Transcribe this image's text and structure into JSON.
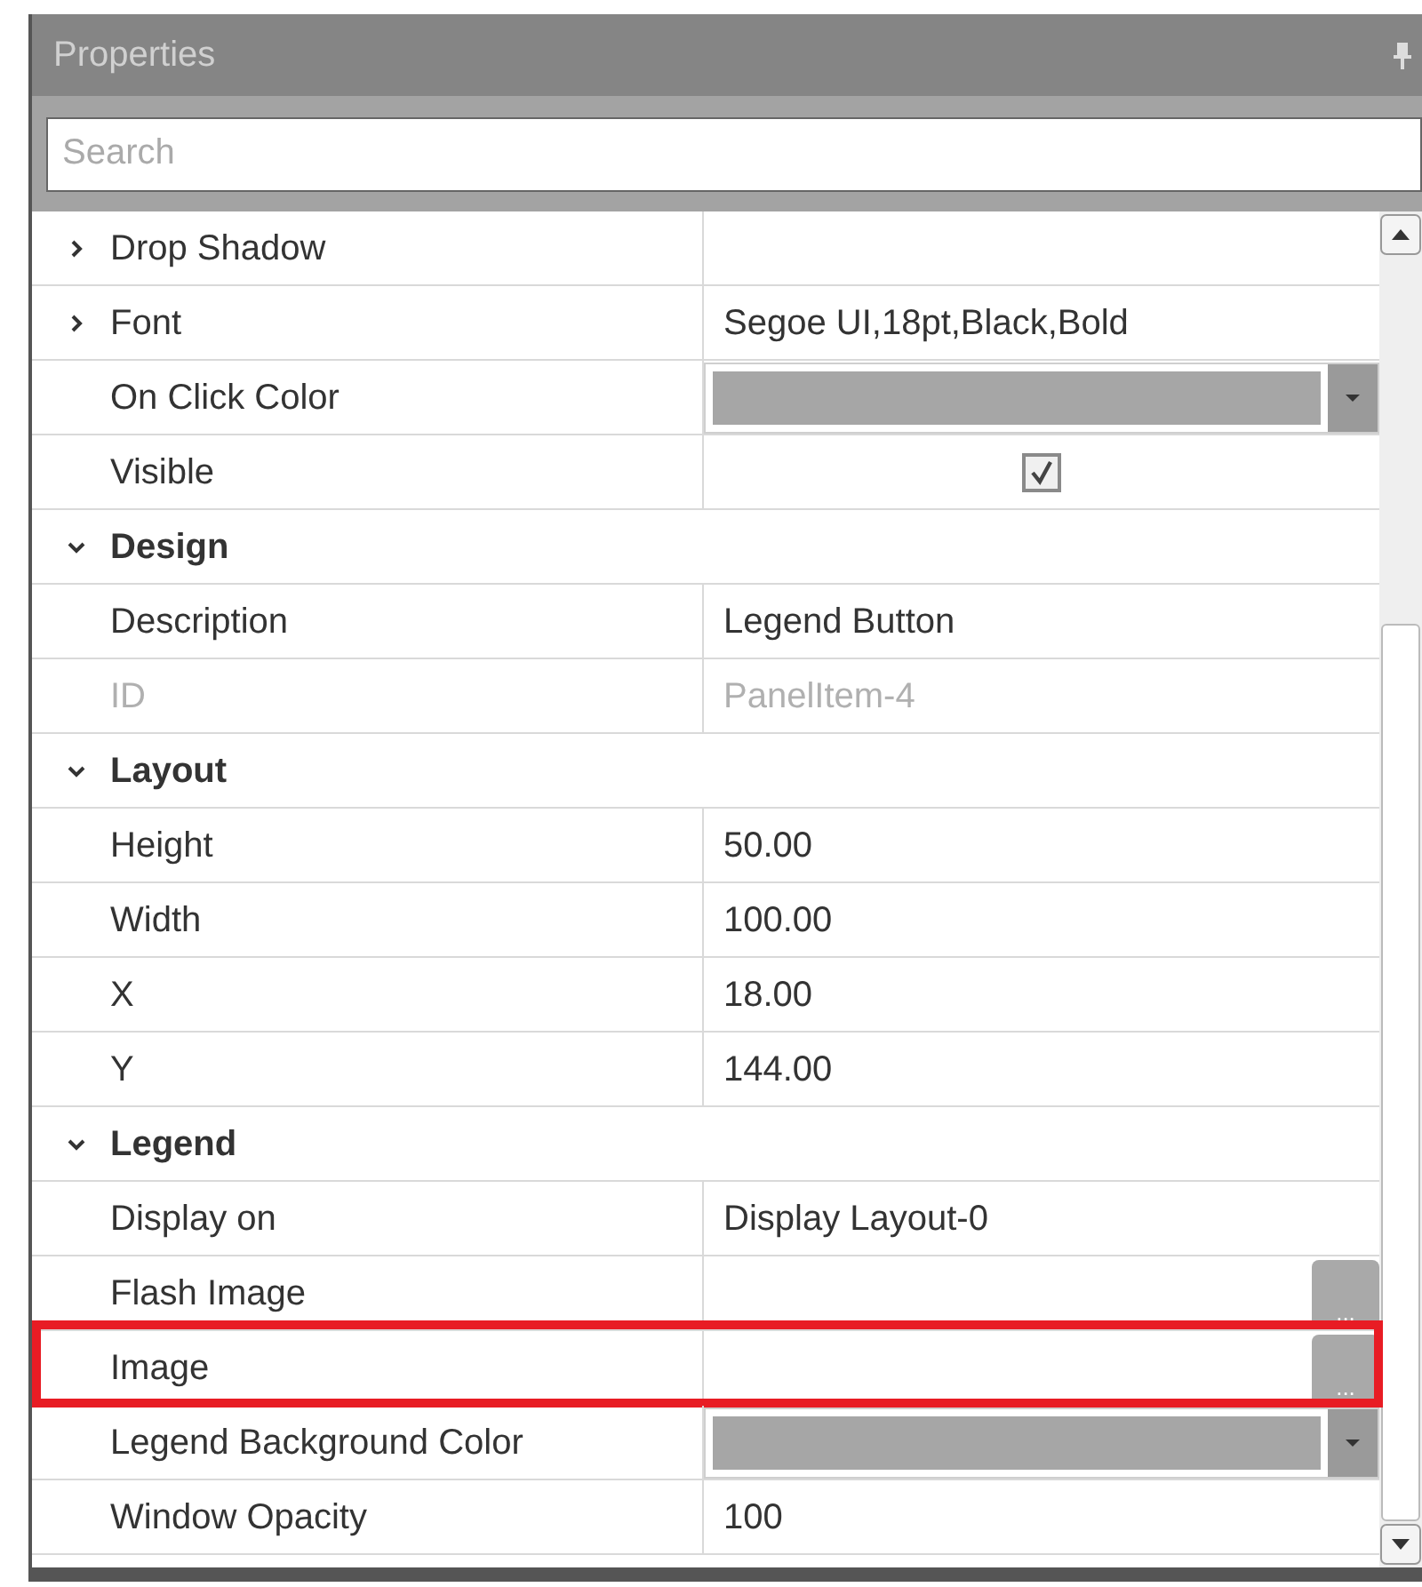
{
  "panel": {
    "title": "Properties"
  },
  "search": {
    "placeholder": "Search"
  },
  "rows": [
    {
      "kind": "expandable",
      "label": "Drop Shadow",
      "expanded": false
    },
    {
      "kind": "expandable",
      "label": "Font",
      "value": "Segoe UI,18pt,Black,Bold",
      "expanded": false
    },
    {
      "kind": "color",
      "label": "On Click Color",
      "color": "#a6a6a6"
    },
    {
      "kind": "checkbox",
      "label": "Visible",
      "checked": true
    },
    {
      "kind": "group",
      "label": "Design",
      "expanded": true
    },
    {
      "kind": "text",
      "label": "Description",
      "value": "Legend Button",
      "disabled": false
    },
    {
      "kind": "text",
      "label": "ID",
      "value": "PanelItem-4",
      "disabled": true
    },
    {
      "kind": "group",
      "label": "Layout",
      "expanded": true
    },
    {
      "kind": "text",
      "label": "Height",
      "value": "50.00",
      "disabled": false
    },
    {
      "kind": "text",
      "label": "Width",
      "value": "100.00",
      "disabled": false
    },
    {
      "kind": "text",
      "label": "X",
      "value": "18.00",
      "disabled": false
    },
    {
      "kind": "text",
      "label": "Y",
      "value": "144.00",
      "disabled": false
    },
    {
      "kind": "group",
      "label": "Legend",
      "expanded": true
    },
    {
      "kind": "text",
      "label": "Display on",
      "value": "Display Layout-0",
      "disabled": false
    },
    {
      "kind": "browse",
      "label": "Flash Image",
      "button": "...",
      "highlighted": false
    },
    {
      "kind": "browse",
      "label": "Image",
      "button": "...",
      "highlighted": true
    },
    {
      "kind": "color",
      "label": "Legend Background Color",
      "color": "#a6a6a6"
    },
    {
      "kind": "text",
      "label": "Window Opacity",
      "value": "100",
      "disabled": false
    }
  ]
}
